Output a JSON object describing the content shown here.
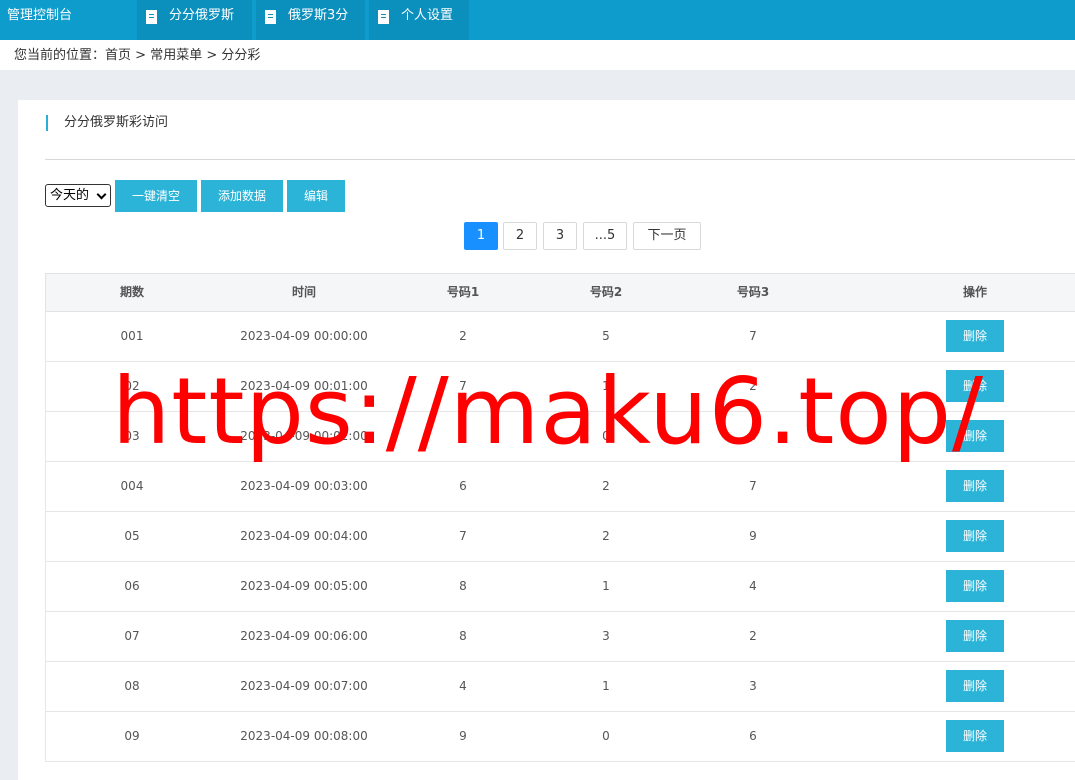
{
  "header": {
    "brand": "管理控制台",
    "tabs": [
      {
        "label": "分分俄罗斯",
        "icon": "document-icon"
      },
      {
        "label": "俄罗斯3分",
        "icon": "document-icon"
      },
      {
        "label": "个人设置",
        "icon": "document-icon"
      }
    ]
  },
  "breadcrumb": {
    "prefix": "您当前的位置：",
    "items": [
      "首页",
      "常用菜单",
      "分分彩"
    ],
    "separator": " > "
  },
  "panel": {
    "title": "分分俄罗斯彩访问"
  },
  "toolbar": {
    "select_value": "今天的",
    "clear_label": "一键清空",
    "add_label": "添加数据",
    "edit_label": "编辑"
  },
  "pagination": {
    "pages": [
      "1",
      "2",
      "3",
      "...5"
    ],
    "active": "1",
    "next_label": "下一页"
  },
  "table": {
    "headers": [
      "期数",
      "时间",
      "号码1",
      "号码2",
      "号码3",
      "操作"
    ],
    "delete_label": "删除",
    "rows": [
      {
        "period": "001",
        "time": "2023-04-09 00:00:00",
        "n1": "2",
        "n2": "5",
        "n3": "7"
      },
      {
        "period": "02",
        "time": "2023-04-09 00:01:00",
        "n1": "7",
        "n2": "1",
        "n3": "2"
      },
      {
        "period": "03",
        "time": "2023-04-09 00:02:00",
        "n1": "0",
        "n2": "0",
        "n3": "0"
      },
      {
        "period": "004",
        "time": "2023-04-09 00:03:00",
        "n1": "6",
        "n2": "2",
        "n3": "7"
      },
      {
        "period": "05",
        "time": "2023-04-09 00:04:00",
        "n1": "7",
        "n2": "2",
        "n3": "9"
      },
      {
        "period": "06",
        "time": "2023-04-09 00:05:00",
        "n1": "8",
        "n2": "1",
        "n3": "4"
      },
      {
        "period": "07",
        "time": "2023-04-09 00:06:00",
        "n1": "8",
        "n2": "3",
        "n3": "2"
      },
      {
        "period": "08",
        "time": "2023-04-09 00:07:00",
        "n1": "4",
        "n2": "1",
        "n3": "3"
      },
      {
        "period": "09",
        "time": "2023-04-09 00:08:00",
        "n1": "9",
        "n2": "0",
        "n3": "6"
      }
    ]
  },
  "watermark": "https://maku6.top/",
  "colors": {
    "topbar": "#0e9ccc",
    "button": "#2bb4d8",
    "active_page": "#1890ff",
    "watermark": "#ff0000"
  }
}
